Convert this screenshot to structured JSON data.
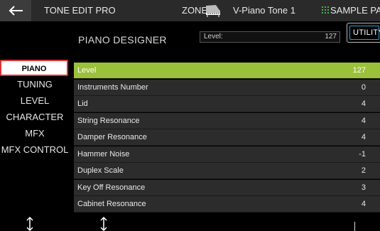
{
  "header": {
    "title": "TONE EDIT PRO",
    "zone": "ZONE1",
    "tone_name": "V-Piano Tone  1",
    "sample_pad": "SAMPLE PAD",
    "icons": [
      "back-arrow-icon",
      "piano-icon",
      "grid-icon"
    ]
  },
  "subheader": {
    "page_title": "PIANO DESIGNER",
    "level_label": "Level:",
    "level_value": "127",
    "utility_label": "UTILITY"
  },
  "menu": {
    "items": [
      {
        "label": "PIANO DESIGNER",
        "selected": true
      },
      {
        "label": "TUNING",
        "selected": false
      },
      {
        "label": "LEVEL",
        "selected": false
      },
      {
        "label": "CHARACTER",
        "selected": false
      },
      {
        "label": "MFX",
        "selected": false
      },
      {
        "label": "MFX CONTROL",
        "selected": false
      }
    ]
  },
  "params": [
    {
      "name": "Level",
      "value": "127",
      "active": true
    },
    {
      "name": "Instruments Number",
      "value": "0"
    },
    {
      "name": "Lid",
      "value": "4"
    },
    {
      "name": "String Resonance",
      "value": "4"
    },
    {
      "name": "Damper Resonance",
      "value": "4"
    },
    {
      "name": "Hammer Noise",
      "value": "-1"
    },
    {
      "name": "Duplex Scale",
      "value": "2"
    },
    {
      "name": "Key Off Resonance",
      "value": "3"
    },
    {
      "name": "Cabinet Resonance",
      "value": "4"
    }
  ],
  "footer": {
    "icons": [
      "up-down-arrow-icon",
      "up-down-arrow-icon"
    ]
  },
  "colors": {
    "active_row": "#9bc03a",
    "row_bg": "#2c2c2c",
    "selected_border": "#dd3333",
    "utility_accent": "#2e9ed8",
    "grid_icon": "#4caf50"
  }
}
